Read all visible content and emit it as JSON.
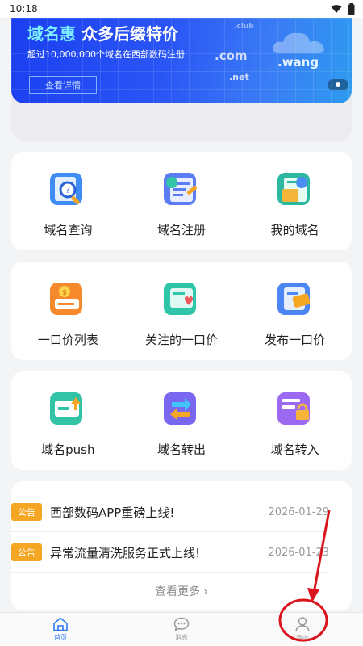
{
  "status_bar": {
    "time": "10:18"
  },
  "banner": {
    "title_highlight": "域名惠",
    "title_rest": "众多后缀特价",
    "subtitle": "超过10,000,000个域名在西部数码注册",
    "button_label": "查看详情",
    "tld_com": ".com",
    "tld_net": ".net",
    "tld_club": ".club",
    "tld_wang": ".wang"
  },
  "grid1": [
    {
      "label": "域名查询",
      "icon": "domain-search-icon"
    },
    {
      "label": "域名注册",
      "icon": "domain-register-icon"
    },
    {
      "label": "我的域名",
      "icon": "my-domain-icon"
    }
  ],
  "grid2": [
    {
      "label": "一口价列表",
      "icon": "fixed-price-list-icon"
    },
    {
      "label": "关注的一口价",
      "icon": "followed-fixed-price-icon"
    },
    {
      "label": "发布一口价",
      "icon": "publish-fixed-price-icon"
    }
  ],
  "grid3": [
    {
      "label": "域名push",
      "icon": "domain-push-icon"
    },
    {
      "label": "域名转出",
      "icon": "domain-transfer-out-icon"
    },
    {
      "label": "域名转入",
      "icon": "domain-transfer-in-icon"
    }
  ],
  "notices": {
    "tag": "公告",
    "items": [
      {
        "text": "西部数码APP重磅上线!",
        "date": "2026-01-29"
      },
      {
        "text": "异常流量清洗服务正式上线!",
        "date": "2026-01-23"
      }
    ],
    "more": "查看更多 ›"
  },
  "bottom_nav": [
    {
      "label": "首页",
      "icon": "home-icon",
      "active": true
    },
    {
      "label": "消息",
      "icon": "message-icon",
      "active": false
    },
    {
      "label": "我的",
      "icon": "user-icon",
      "active": false
    }
  ],
  "colors": {
    "accent": "#2c7bf5",
    "tag": "#f5a623",
    "annotation": "#d9141c"
  }
}
